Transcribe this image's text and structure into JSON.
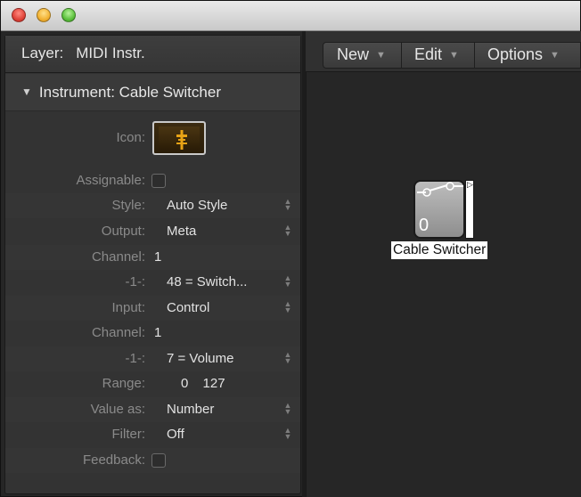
{
  "window": {
    "controls": [
      "close",
      "minimize",
      "zoom"
    ]
  },
  "inspector": {
    "layer_label": "Layer:",
    "layer_value": "MIDI Instr.",
    "section_title": "Instrument: Cable Switcher",
    "fields": {
      "icon_label": "Icon:",
      "icon_glyph": "cable-switcher-icon",
      "assignable_label": "Assignable:",
      "style_label": "Style:",
      "style_value": "Auto Style",
      "output_label": "Output:",
      "output_value": "Meta",
      "channel1_label": "Channel:",
      "channel1_value": "1",
      "out_param_label": "-1-:",
      "out_param_value": "48 = Switch...",
      "input_label": "Input:",
      "input_value": "Control",
      "channel2_label": "Channel:",
      "channel2_value": "1",
      "in_param_label": "-1-:",
      "in_param_value": "7 = Volume",
      "range_label": "Range:",
      "range_min": "0",
      "range_max": "127",
      "valueas_label": "Value as:",
      "valueas_value": "Number",
      "filter_label": "Filter:",
      "filter_value": "Off",
      "feedback_label": "Feedback:"
    }
  },
  "toolbar": {
    "new_label": "New",
    "edit_label": "Edit",
    "options_label": "Options"
  },
  "canvas": {
    "object_label": "Cable Switcher",
    "object_value": "0"
  },
  "colors": {
    "panel": "#333333",
    "label_gray": "#8a8a8a",
    "value_white": "#e2e2e2",
    "icon_amber": "#e8a316"
  }
}
